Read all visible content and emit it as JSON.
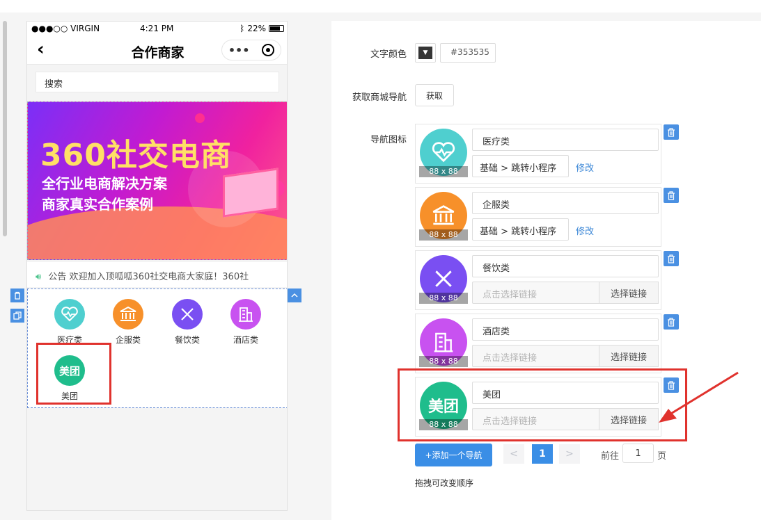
{
  "phone": {
    "status": {
      "carrier": "●●●○○ VIRGIN",
      "time": "4:21 PM",
      "battery": "22%"
    },
    "nav_title": "合作商家",
    "capsule_dots": "•••",
    "search_placeholder": "搜索",
    "banner": {
      "title": "360社交电商",
      "line1": "全行业电商解决方案",
      "line2": "商家真实合作案例"
    },
    "notice": "公告  欢迎加入顶呱呱360社交电商大家庭！360社",
    "nav_items": [
      {
        "label": "医疗类",
        "color": "#4fcfcf",
        "icon": "heart-pulse-icon"
      },
      {
        "label": "企服类",
        "color": "#f7902a",
        "icon": "bank-building-icon"
      },
      {
        "label": "餐饮类",
        "color": "#7a4ff2",
        "icon": "fork-knife-icon"
      },
      {
        "label": "酒店类",
        "color": "#c852f0",
        "icon": "hotel-building-icon"
      },
      {
        "label": "美团",
        "color": "#1fbd8c",
        "icon": "meituan-logo-icon"
      }
    ]
  },
  "panel": {
    "text_color_label": "文字颜色",
    "text_color_value": "#353535",
    "fetch_nav_label": "获取商城导航",
    "fetch_button": "获取",
    "nav_icon_label": "导航图标",
    "thumb_size": "88 x 88",
    "cards": [
      {
        "name": "医疗类",
        "link": "基础 > 跳转小程序",
        "modify": "修改",
        "color": "#4fcfcf"
      },
      {
        "name": "企服类",
        "link": "基础 > 跳转小程序",
        "modify": "修改",
        "color": "#f7902a"
      },
      {
        "name": "餐饮类",
        "link_placeholder": "点击选择链接",
        "choose": "选择链接",
        "color": "#7a4ff2"
      },
      {
        "name": "酒店类",
        "link_placeholder": "点击选择链接",
        "choose": "选择链接",
        "color": "#c852f0"
      },
      {
        "name": "美团",
        "link_placeholder": "点击选择链接",
        "choose": "选择链接",
        "color": "#1fbd8c",
        "logo_text": "美团"
      }
    ],
    "add_button": "+添加一个导航",
    "pagination": {
      "prev": "<",
      "current": "1",
      "next": ">",
      "goto_label": "前往",
      "goto_value": "1",
      "page_label": "页"
    },
    "hint": "拖拽可改变顺序"
  }
}
